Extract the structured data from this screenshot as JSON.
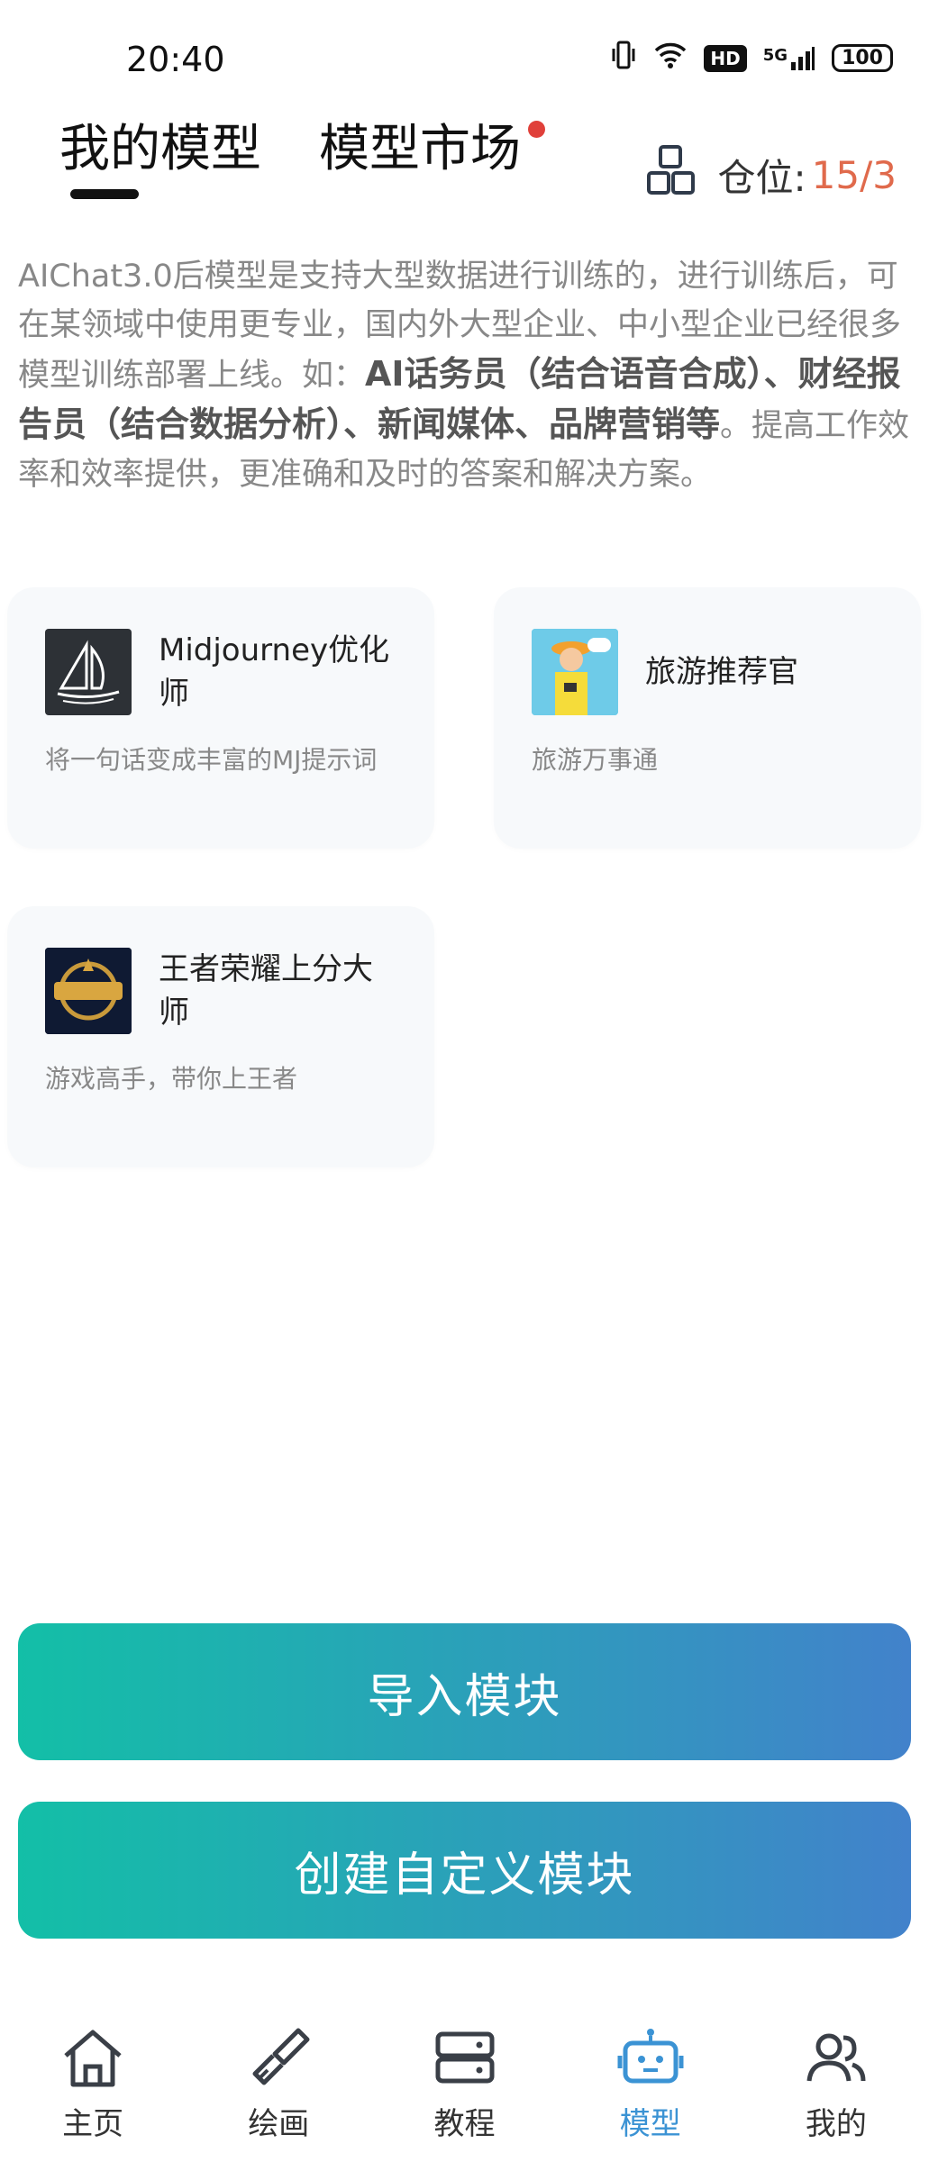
{
  "status_bar": {
    "time": "20:40",
    "hd": "HD",
    "network": "5G",
    "battery": "100"
  },
  "tabs": [
    {
      "label": "我的模型",
      "active": true
    },
    {
      "label": "模型市场",
      "active": false
    }
  ],
  "slot": {
    "label": "仓位:",
    "used": "15",
    "sep": "/",
    "total": "3"
  },
  "intro": {
    "part1": "AIChat3.0后模型是支持大型数据进行训练的，进行训练后，可在某领域中使用更专业，国内外大型企业、中小型企业已经很多模型训练部署上线。如：",
    "bold": "AI话务员（结合语音合成）、财经报告员（结合数据分析）、新闻媒体、品牌营销等",
    "part2": "。提高工作效率和效率提供，更准确和及时的答案和解决方案。"
  },
  "models": [
    {
      "title": "Midjourney优化师",
      "desc": "将一句话变成丰富的MJ提示词",
      "icon": "sailboat-logo"
    },
    {
      "title": "旅游推荐官",
      "desc": "旅游万事通",
      "icon": "travel-girl-avatar"
    },
    {
      "title": "王者荣耀上分大师",
      "desc": "游戏高手，带你上王者",
      "icon": "game-logo"
    }
  ],
  "buttons": {
    "import": "导入模块",
    "create": "创建自定义模块"
  },
  "nav": [
    {
      "label": "主页",
      "icon": "home-icon"
    },
    {
      "label": "绘画",
      "icon": "brush-icon"
    },
    {
      "label": "教程",
      "icon": "server-icon"
    },
    {
      "label": "模型",
      "icon": "robot-icon",
      "active": true
    },
    {
      "label": "我的",
      "icon": "users-icon"
    }
  ],
  "colors": {
    "accent": "#3b93d4",
    "badge": "#e0403a",
    "slot_value": "#e06a4c",
    "gradient_start": "#13bfa7",
    "gradient_end": "#4282cb"
  }
}
